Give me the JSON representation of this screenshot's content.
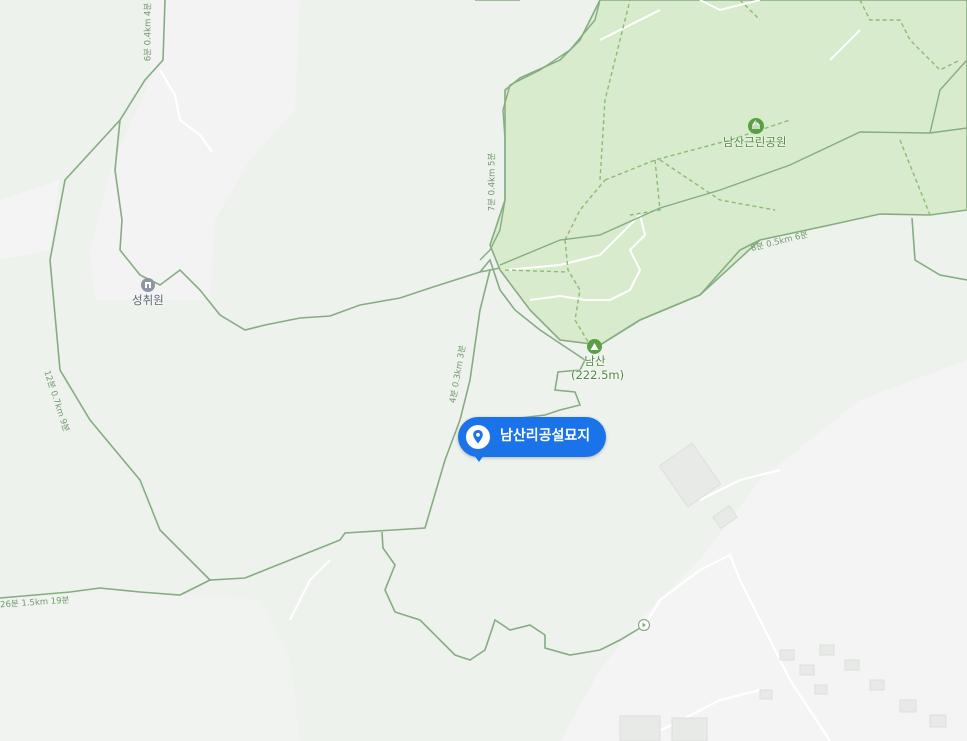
{
  "map": {
    "colors": {
      "land": "#eef2ed",
      "urban": "#f3f4f3",
      "park": "#d8ebcc",
      "trail": "#86ad82",
      "park_path": "#8cbc73",
      "pin": "#1a73e8"
    },
    "selected_place": {
      "name": "남산리공설묘지",
      "icon": "location-pin-icon"
    },
    "park": {
      "name": "남산근린공원",
      "icon": "tree-icon"
    },
    "peak": {
      "name": "남산",
      "elevation": "(222.5m)",
      "icon": "mountain-icon"
    },
    "poi": {
      "name": "성취원",
      "icon": "building-icon"
    },
    "trail_labels": [
      "6분 0.4km 4분",
      "7분 0.4km 5분",
      "12분 0.7km 9분",
      "4분 0.3km 3분",
      "8분 0.5km 6분",
      "26분 1.5km 19분"
    ]
  }
}
